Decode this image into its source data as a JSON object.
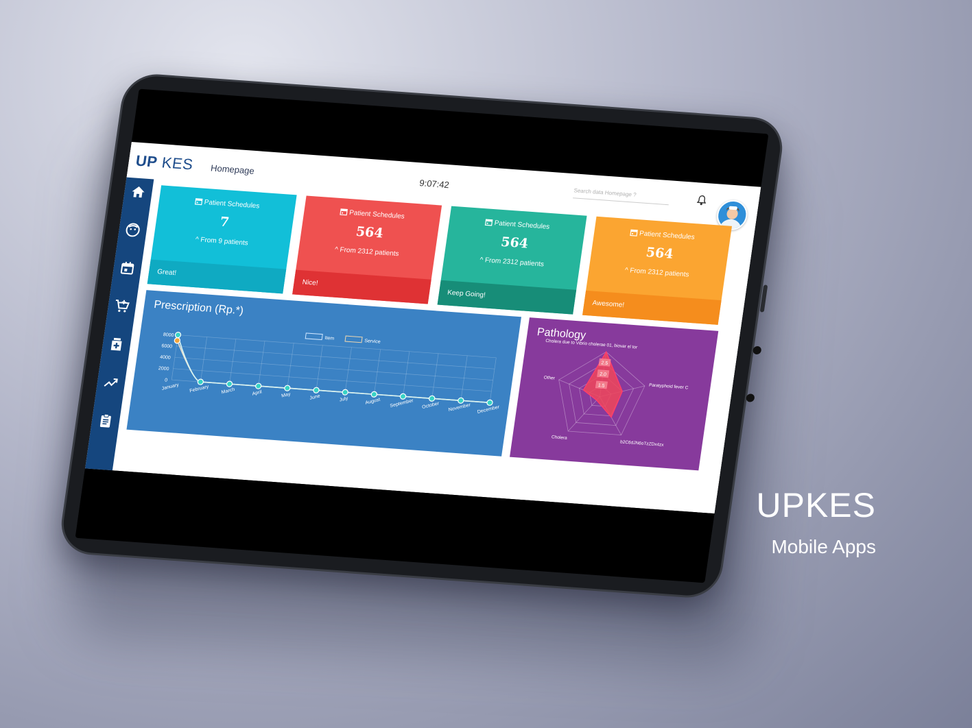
{
  "header": {
    "logo_bold": "UP",
    "logo_light": " KES",
    "breadcrumb": "Homepage",
    "clock": "9:07:42",
    "search_placeholder": "Search data Homepage ?"
  },
  "sidebar": {
    "items": [
      {
        "icon": "home-icon"
      },
      {
        "icon": "patient-face-icon"
      },
      {
        "icon": "calendar-icon"
      },
      {
        "icon": "cart-add-icon"
      },
      {
        "icon": "pharmacy-icon"
      },
      {
        "icon": "trend-up-icon"
      },
      {
        "icon": "clipboard-icon"
      }
    ]
  },
  "cards": [
    {
      "title": "Patient Schedules",
      "value": "7",
      "sub": "From 9 patients",
      "foot": "Great!",
      "color": "#12bfd8",
      "foot_color": "#0faac2"
    },
    {
      "title": "Patient Schedules",
      "value": "564",
      "sub": "From 2312 patients",
      "foot": "Nice!",
      "color": "#ef5150",
      "foot_color": "#df3234"
    },
    {
      "title": "Patient Schedules",
      "value": "564",
      "sub": "From 2312 patients",
      "foot": "Keep Going!",
      "color": "#26b59c",
      "foot_color": "#178d78"
    },
    {
      "title": "Patient Schedules",
      "value": "564",
      "sub": "From 2312 patients",
      "foot": "Awesome!",
      "color": "#fba531",
      "foot_color": "#f58d1d"
    }
  ],
  "prescription": {
    "title": "Prescription (Rp.*)",
    "legend": [
      "Item",
      "Service"
    ]
  },
  "pathology": {
    "title": "Pathology",
    "axis_labels": [
      "Cholera due to Vibrio cholerae 01, biovar el tor",
      "Paratyphoid fever C",
      "b2C6dJN6oTzZDx4zx",
      "Cholera",
      "Other"
    ],
    "ring_labels": [
      "2.5",
      "2.0",
      "1.5"
    ]
  },
  "caption": {
    "brand": "UPKES",
    "tagline": "Mobile Apps"
  },
  "chart_data": [
    {
      "type": "line",
      "title": "Prescription (Rp.*)",
      "x": [
        "January",
        "February",
        "March",
        "April",
        "May",
        "June",
        "July",
        "August",
        "September",
        "October",
        "November",
        "December"
      ],
      "series": [
        {
          "name": "Item",
          "values": [
            8000,
            0,
            0,
            0,
            0,
            0,
            0,
            0,
            0,
            0,
            0,
            0
          ],
          "color": "#38d3c6"
        },
        {
          "name": "Service",
          "values": [
            7000,
            0,
            0,
            0,
            0,
            0,
            0,
            0,
            0,
            0,
            0,
            0
          ],
          "color": "#f3a43b"
        }
      ],
      "yticks": [
        "8000",
        "6000",
        "4000",
        "2000",
        "0"
      ],
      "ylim": [
        0,
        8000
      ],
      "grid": true,
      "legend": "top-center"
    },
    {
      "type": "radar",
      "title": "Pathology",
      "categories": [
        "Cholera due to Vibrio cholerae 01, biovar el tor",
        "Paratyphoid fever C",
        "b2C6dJN6oTzZDx4zx",
        "Cholera",
        "Other"
      ],
      "values": [
        3.0,
        1.5,
        1.6,
        0.3,
        1.2
      ],
      "rmax": 3.0
    }
  ]
}
